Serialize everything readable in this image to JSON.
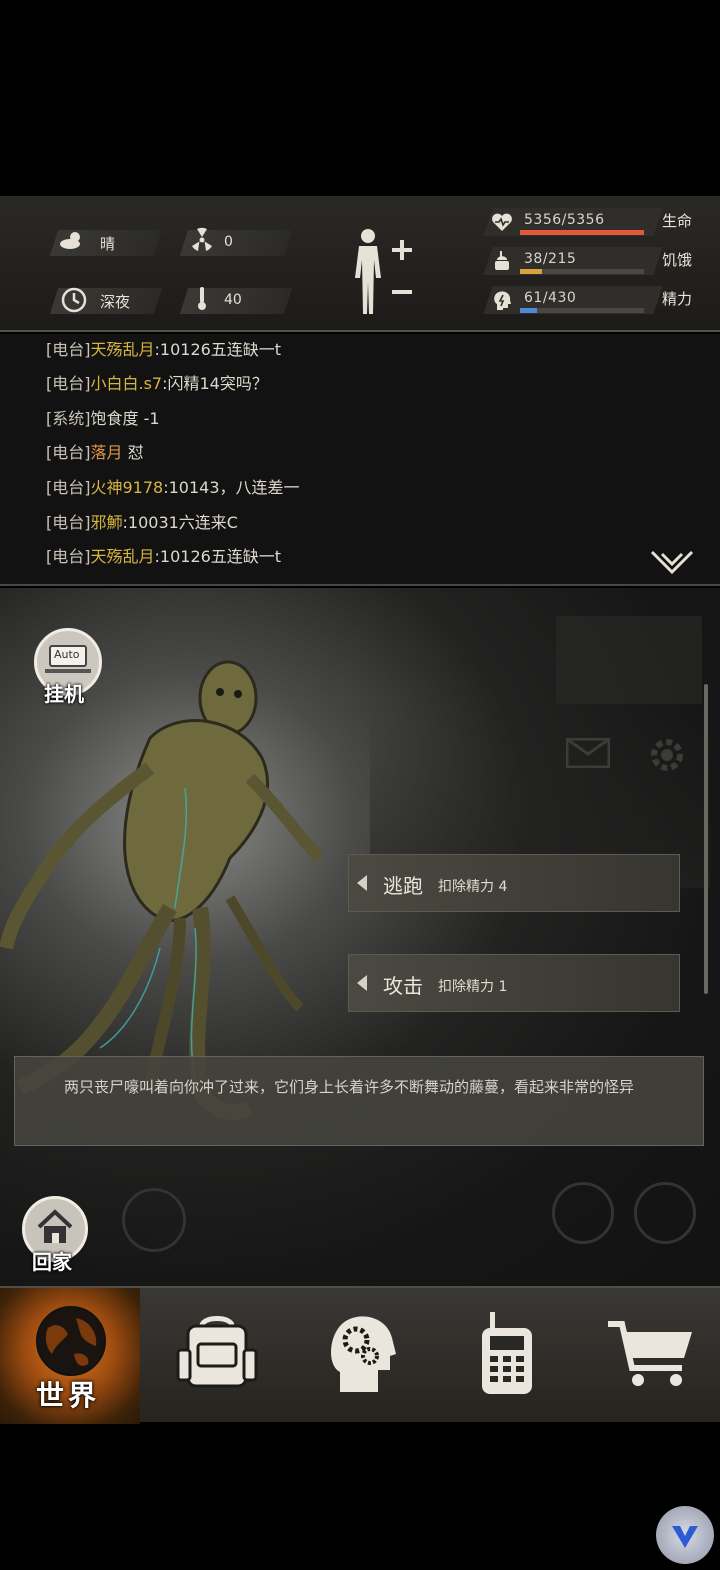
{
  "status": {
    "weather": {
      "icon": "cloud-sun-icon",
      "label": "晴"
    },
    "radiation": {
      "icon": "radiation-icon",
      "value": "0"
    },
    "time": {
      "icon": "clock-icon",
      "label": "深夜"
    },
    "temperature": {
      "icon": "thermometer-icon",
      "value": "40"
    },
    "body_icon": "body-status-icon",
    "bars": [
      {
        "icon": "heart-pulse-icon",
        "value": "5356/5356",
        "label": "生命",
        "fraction": 1.0,
        "color": "#e2583a"
      },
      {
        "icon": "food-icon",
        "value": "38/215",
        "label": "饥饿",
        "fraction": 0.18,
        "color": "#d9a23a"
      },
      {
        "icon": "brain-icon",
        "value": "61/430",
        "label": "精力",
        "fraction": 0.14,
        "color": "#4f8ad6"
      }
    ]
  },
  "chat": {
    "lines": [
      {
        "tag": "[电台]",
        "name": "天殇乱月",
        "name_color": "#d6b542",
        "msg": ":10126五连缺一t"
      },
      {
        "tag": "[电台]",
        "name": "小白白.s7",
        "name_color": "#d6b542",
        "msg": ":闪精14突吗？"
      },
      {
        "tag": "[系统]",
        "name": "",
        "name_color": "#d6b542",
        "msg": "饱食度 -1"
      },
      {
        "tag": "[电台]",
        "name": "落月",
        "name_color": "#e0944a",
        "msg": " 怼"
      },
      {
        "tag": "[电台]",
        "name": "火神9178",
        "name_color": "#d6b542",
        "msg": ":10143，八连差一"
      },
      {
        "tag": "[电台]",
        "name": "邪魳",
        "name_color": "#d6b542",
        "msg": ":10031六连来C"
      },
      {
        "tag": "[电台]",
        "name": "天殇乱月",
        "name_color": "#d6b542",
        "msg": ":10126五连缺一t"
      }
    ]
  },
  "scene": {
    "auto": {
      "badge": "Auto",
      "label": "挂机"
    },
    "actions": [
      {
        "name": "逃跑",
        "cost": "扣除精力 4"
      },
      {
        "name": "攻击",
        "cost": "扣除精力 1"
      }
    ],
    "story": "两只丧尸嚎叫着向你冲了过来，它们身上长着许多不断舞动的藤蔓，看起来非常的怪异",
    "home_label": "回家"
  },
  "nav": {
    "items": [
      {
        "icon": "globe-icon",
        "label": "世界",
        "active": true
      },
      {
        "icon": "backpack-icon",
        "label": "",
        "active": false
      },
      {
        "icon": "head-gears-icon",
        "label": "",
        "active": false
      },
      {
        "icon": "radio-icon",
        "label": "",
        "active": false
      },
      {
        "icon": "cart-icon",
        "label": "",
        "active": false
      }
    ]
  }
}
